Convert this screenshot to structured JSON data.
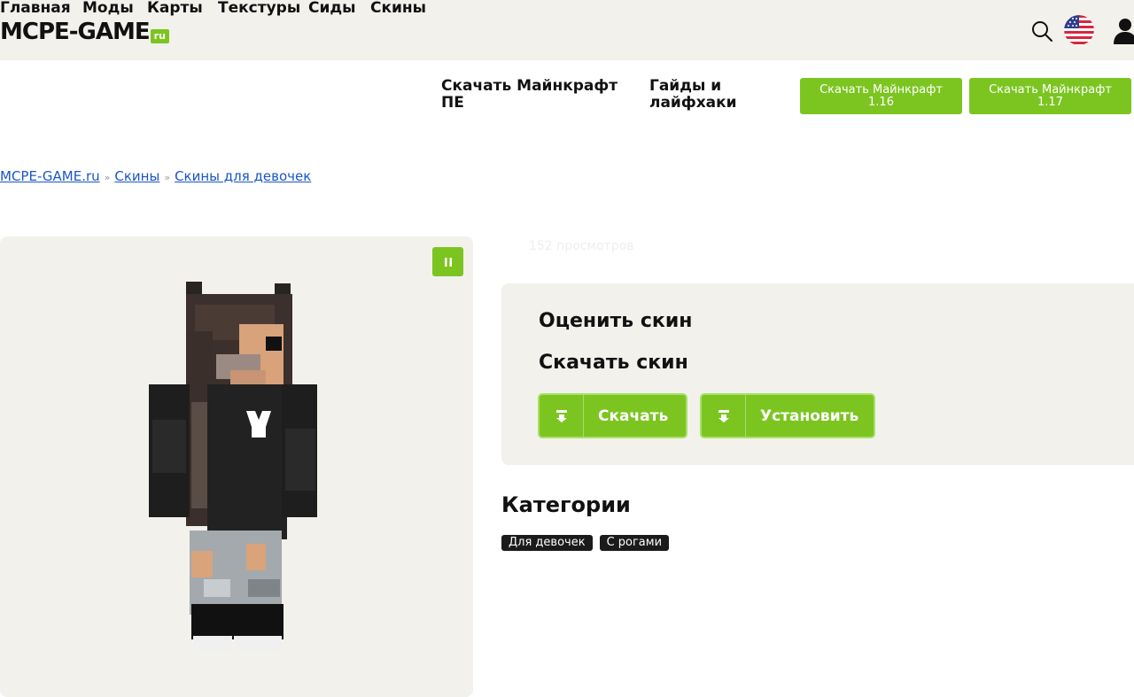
{
  "header": {
    "logo_main": "MCPE-GAME",
    "logo_tld": "ru"
  },
  "nav": {
    "items": [
      {
        "label": "Главная"
      },
      {
        "label": "Моды"
      },
      {
        "label": "Карты"
      },
      {
        "label": "Текстуры"
      },
      {
        "label": "Сиды"
      },
      {
        "label": "Скины"
      },
      {
        "label": "Скачать Майнкрафт ПЕ"
      },
      {
        "label": "Гайды и лайфхаки"
      }
    ],
    "buttons": [
      {
        "line1": "Скачать Майнкрафт",
        "line2": "1.16"
      },
      {
        "line1": "Скачать Майнкрафт",
        "line2": "1.17"
      }
    ]
  },
  "breadcrumb": {
    "items": [
      "MCPE-GAME.ru",
      "Скины",
      "Скины для девочек"
    ],
    "separator": "»"
  },
  "skin": {
    "views": "152 просмотров"
  },
  "actions": {
    "rate_title": "Оценить скин",
    "download_title": "Скачать скин",
    "download_label": "Скачать",
    "install_label": "Установить"
  },
  "categories": {
    "title": "Категории",
    "tags": [
      "Для девочек",
      "С рогами"
    ]
  },
  "colors": {
    "accent": "#7cc521",
    "panel": "#f3f1ec",
    "link": "#1a56c5"
  }
}
